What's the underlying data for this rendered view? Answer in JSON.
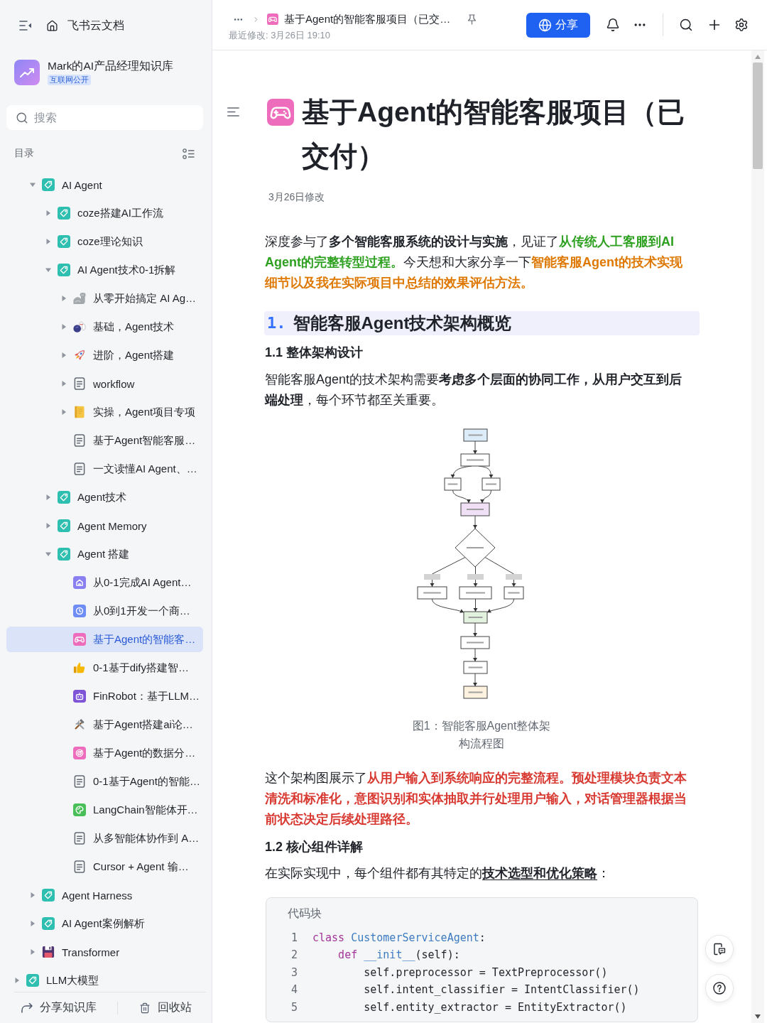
{
  "sidebar": {
    "title": "飞书云文档",
    "space": {
      "name": "Mark的AI产品经理知识库",
      "badge": "互联网公开"
    },
    "search": {
      "placeholder": "搜索"
    },
    "toc_label": "目录",
    "tree": [
      {
        "children": [
          {
            "label": "AI Agent",
            "kind": "tag",
            "expanded": true,
            "selected": false,
            "children": [
              {
                "label": "coze搭建AI工作流",
                "kind": "tag",
                "expanded": false,
                "selected": false
              },
              {
                "label": "coze理论知识",
                "kind": "tag",
                "expanded": false,
                "selected": false
              },
              {
                "label": "AI Agent技术0-1拆解",
                "kind": "tag",
                "expanded": true,
                "selected": false,
                "children": [
                  {
                    "label": "从零开始搞定 AI Ag…",
                    "kind": "arm",
                    "expanded": false,
                    "selected": false
                  },
                  {
                    "label": "基础，Agent技术",
                    "kind": "bowling",
                    "expanded": false,
                    "selected": false
                  },
                  {
                    "label": "进阶，Agent搭建",
                    "kind": "rocket",
                    "expanded": false,
                    "selected": false
                  },
                  {
                    "label": "workflow",
                    "kind": "doc",
                    "expanded": false,
                    "selected": false
                  },
                  {
                    "label": "实操，Agent项目专项",
                    "kind": "notebook",
                    "expanded": false,
                    "selected": false
                  },
                  {
                    "label": "基于Agent智能客服…",
                    "kind": "doc",
                    "selected": false
                  },
                  {
                    "label": "一文读懂AI Agent、…",
                    "kind": "doc",
                    "selected": false
                  }
                ]
              },
              {
                "label": "Agent技术",
                "kind": "tag",
                "expanded": false,
                "selected": false
              },
              {
                "label": "Agent Memory",
                "kind": "tag",
                "expanded": false,
                "selected": false
              },
              {
                "label": "Agent 搭建",
                "kind": "tag",
                "expanded": true,
                "selected": false,
                "children": [
                  {
                    "label": "从0-1完成AI Agent…",
                    "kind": "house",
                    "selected": false
                  },
                  {
                    "label": "从0到1开发一个商…",
                    "kind": "clock",
                    "selected": false
                  },
                  {
                    "label": "基于Agent的智能客…",
                    "kind": "gamepad",
                    "selected": true
                  },
                  {
                    "label": "0-1基于dify搭建智…",
                    "kind": "thumbs",
                    "selected": false
                  },
                  {
                    "label": "FinRobot：基于LLM…",
                    "kind": "robot",
                    "selected": false
                  },
                  {
                    "label": "基于Agent搭建ai论…",
                    "kind": "tools",
                    "selected": false
                  },
                  {
                    "label": "基于Agent的数据分…",
                    "kind": "target",
                    "selected": false
                  },
                  {
                    "label": "0-1基于Agent的智能…",
                    "kind": "doc",
                    "selected": false
                  },
                  {
                    "label": "LangChain智能体开…",
                    "kind": "palette",
                    "selected": false
                  },
                  {
                    "label": "从多智能体协作到 A…",
                    "kind": "doc",
                    "selected": false
                  },
                  {
                    "label": "Cursor + Agent 输…",
                    "kind": "doc",
                    "selected": false
                  }
                ]
              }
            ]
          },
          {
            "label": "Agent Harness",
            "kind": "tag",
            "expanded": false,
            "selected": false
          },
          {
            "label": "AI Agent案例解析",
            "kind": "tag",
            "expanded": false,
            "selected": false
          },
          {
            "label": "Transformer",
            "kind": "floppy",
            "expanded": false,
            "selected": false
          }
        ]
      },
      {
        "label": "LLM大模型",
        "kind": "tag",
        "expanded": false,
        "selected": false
      }
    ],
    "share_label": "分享知识库",
    "recycle_label": "回收站"
  },
  "topbar": {
    "breadcrumb_title": "基于Agent的智能客服项目（已交…",
    "last_modified": "最近修改: 3月26日 19:10",
    "share_label": "分享"
  },
  "document": {
    "title": "基于Agent的智能客服项目（已交付）",
    "modified": "3月26日修改",
    "blocks": [
      {
        "kind": "paragraph",
        "runs": [
          {
            "text": "深度参与了"
          },
          {
            "text": "多个智能客服系统的设计与实施",
            "kind": "bold"
          },
          {
            "text": "，见证了"
          },
          {
            "text": "从传统人工客服到AI Agent的完整转型过程。",
            "kind": "green"
          },
          {
            "text": "今天想和大家分享一下"
          },
          {
            "text": "智能客服Agent的技术实现细节以及我在实际项目中总结的效果评估方法。",
            "kind": "orange"
          }
        ]
      },
      {
        "kind": "heading1",
        "number": "1.",
        "text": "智能客服Agent技术架构概览"
      },
      {
        "kind": "heading2",
        "text": "1.1 整体架构设计"
      },
      {
        "kind": "paragraph",
        "runs": [
          {
            "text": "智能客服Agent的技术架构需要"
          },
          {
            "text": "考虑多个层面的协同工作，从用户交互到后端处理",
            "kind": "bold"
          },
          {
            "text": "，每个环节都至关重要。"
          }
        ]
      },
      {
        "kind": "figure",
        "caption": "图1：智能客服Agent整体架构流程图"
      },
      {
        "kind": "paragraph",
        "runs": [
          {
            "text": "这个架构图展示了"
          },
          {
            "text": "从用户输入到系统响应的完整流程。预处理模块负责文本清洗和标准化，意图识别和实体抽取并行处理用户输入，对话管理器根据当前状态决定后续处理路径。",
            "kind": "red"
          }
        ]
      },
      {
        "kind": "heading2",
        "text": "1.2 核心组件详解"
      },
      {
        "kind": "paragraph",
        "runs": [
          {
            "text": "在实际实现中，每个组件都有其特定的"
          },
          {
            "text": "技术选型和优化策略",
            "kind": "bold_underline"
          },
          {
            "text": "："
          }
        ]
      },
      {
        "kind": "code",
        "label": "代码块",
        "lines": [
          {
            "number": "1",
            "tokens": [
              {
                "text": "class ",
                "kind": "keyword"
              },
              {
                "text": "CustomerServiceAgent",
                "kind": "name"
              },
              {
                "text": ":"
              }
            ]
          },
          {
            "number": "2",
            "tokens": [
              {
                "text": "    def ",
                "kind": "keyword"
              },
              {
                "text": "__init__",
                "kind": "name"
              },
              {
                "text": "(self):"
              }
            ]
          },
          {
            "number": "3",
            "tokens": [
              {
                "text": "        self.preprocessor = TextPreprocessor()"
              }
            ]
          },
          {
            "number": "4",
            "tokens": [
              {
                "text": "        self.intent_classifier = IntentClassifier()"
              }
            ]
          },
          {
            "number": "5",
            "tokens": [
              {
                "text": "        self.entity_extractor = EntityExtractor()"
              }
            ]
          }
        ]
      }
    ]
  }
}
